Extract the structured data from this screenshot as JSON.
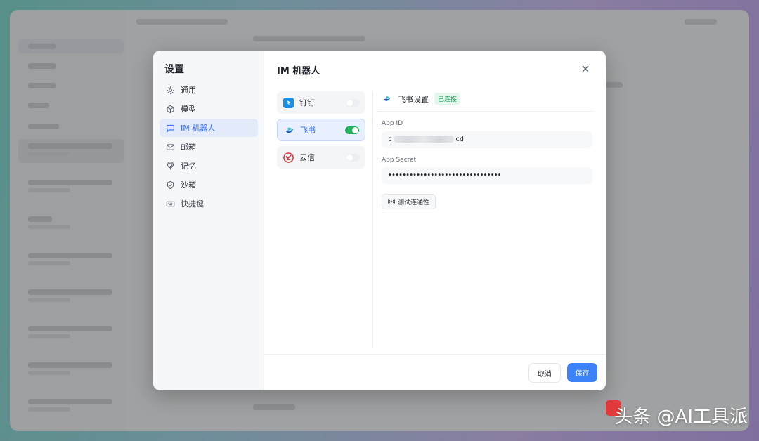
{
  "settings": {
    "title": "设置",
    "nav": [
      {
        "label": "通用",
        "icon": "gear-icon"
      },
      {
        "label": "模型",
        "icon": "cube-icon"
      },
      {
        "label": "IM 机器人",
        "icon": "chat-icon"
      },
      {
        "label": "邮箱",
        "icon": "mail-icon"
      },
      {
        "label": "记忆",
        "icon": "brain-icon"
      },
      {
        "label": "沙箱",
        "icon": "shield-icon"
      },
      {
        "label": "快捷键",
        "icon": "keyboard-icon"
      }
    ],
    "active_nav": "IM 机器人"
  },
  "panel": {
    "title": "IM 机器人",
    "bots": [
      {
        "name": "钉钉",
        "enabled": false,
        "icon": "dingtalk-logo-icon"
      },
      {
        "name": "飞书",
        "enabled": true,
        "icon": "feishu-logo-icon"
      },
      {
        "name": "云信",
        "enabled": false,
        "icon": "yunxin-logo-icon"
      }
    ],
    "selected_bot": "飞书"
  },
  "detail": {
    "title": "飞书设置",
    "status_badge": "已连接",
    "app_id_label": "App ID",
    "app_id_prefix": "c",
    "app_id_suffix": "cd",
    "app_secret_label": "App Secret",
    "app_secret_value": "••••••••••••••••••••••••••••••••",
    "test_button": "测试连通性"
  },
  "footer": {
    "cancel": "取消",
    "save": "保存"
  },
  "watermark": "头条 @AI工具派",
  "colors": {
    "accent": "#3370ff",
    "save_button": "#3b82f6",
    "toggle_on": "#22b35e",
    "badge_text": "#22a05a"
  }
}
